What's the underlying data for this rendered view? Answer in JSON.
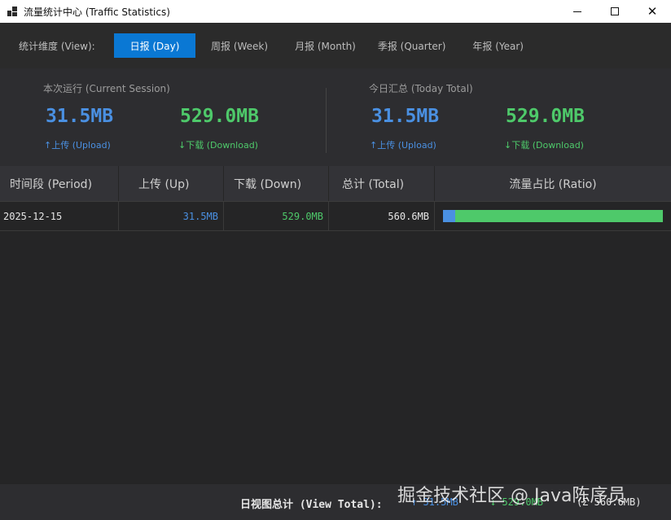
{
  "window": {
    "title": "流量统计中心 (Traffic Statistics)",
    "min_glyph": "—",
    "max_glyph": "☐",
    "close_glyph": "✕"
  },
  "toolbar": {
    "view_label": "统计维度 (View):",
    "tabs": [
      {
        "label": "日报 (Day)",
        "active": true
      },
      {
        "label": "周报 (Week)",
        "active": false
      },
      {
        "label": "月报 (Month)",
        "active": false
      },
      {
        "label": "季报 (Quarter)",
        "active": false
      },
      {
        "label": "年报 (Year)",
        "active": false
      }
    ]
  },
  "session": {
    "title": "本次运行 (Current Session)",
    "upload_value": "31.5MB",
    "download_value": "529.0MB",
    "upload_label": "↑上传 (Upload)",
    "download_label": "↓下载 (Download)"
  },
  "today": {
    "title": "今日汇总 (Today Total)",
    "upload_value": "31.5MB",
    "download_value": "529.0MB",
    "upload_label": "↑上传 (Upload)",
    "download_label": "↓下载 (Download)"
  },
  "table": {
    "headers": [
      "时间段 (Period)",
      "上传 (Up)",
      "下载 (Down)",
      "总计 (Total)",
      "流量占比 (Ratio)"
    ],
    "rows": [
      {
        "period": "2025-12-15",
        "up": "31.5MB",
        "down": "529.0MB",
        "total": "560.6MB",
        "up_ratio": 0.056
      }
    ]
  },
  "footer": {
    "label": "日视图总计 (View Total):",
    "up": "↑ 31.5MB",
    "down": "↓ 529.0MB",
    "total": "(Σ 560.6MB)"
  },
  "watermark": "掘金技术社区 @ Java陈序员",
  "colors": {
    "accent": "#0a78d4",
    "upload": "#4a90e2",
    "download": "#4ec96a"
  }
}
